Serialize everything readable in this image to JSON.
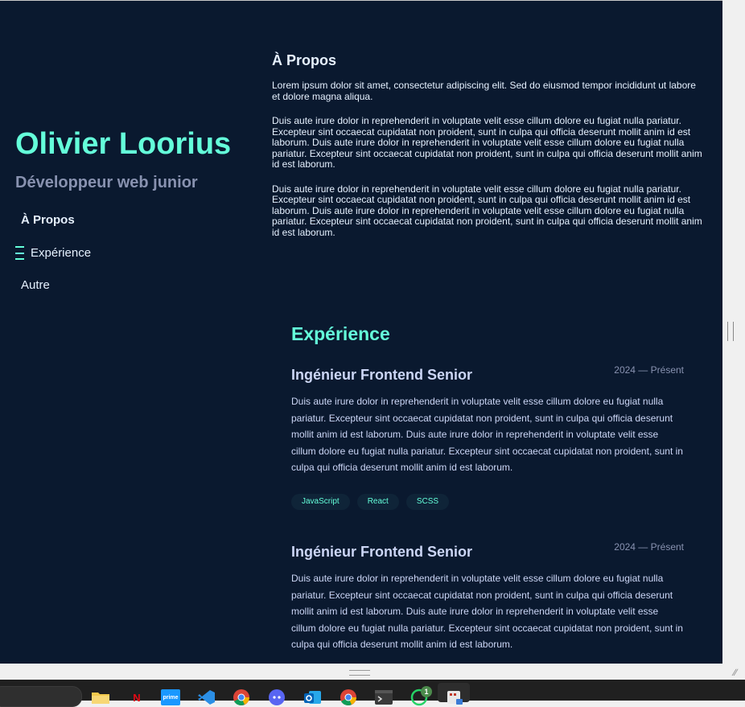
{
  "profile": {
    "name": "Olivier Loorius",
    "role": "Développeur web junior"
  },
  "nav": {
    "items": [
      {
        "label": "À Propos"
      },
      {
        "label": "Expérience"
      },
      {
        "label": "Autre"
      }
    ]
  },
  "about": {
    "title": "À Propos",
    "paragraphs": [
      "Lorem ipsum dolor sit amet, consectetur adipiscing elit. Sed do eiusmod tempor incididunt ut labore et dolore magna aliqua.",
      "Duis aute irure dolor in reprehenderit in voluptate velit esse cillum dolore eu fugiat nulla pariatur. Excepteur sint occaecat cupidatat non proident, sunt in culpa qui officia deserunt mollit anim id est laborum. Duis aute irure dolor in reprehenderit in voluptate velit esse cillum dolore eu fugiat nulla pariatur. Excepteur sint occaecat cupidatat non proident, sunt in culpa qui officia deserunt mollit anim id est laborum.",
      "Duis aute irure dolor in reprehenderit in voluptate velit esse cillum dolore eu fugiat nulla pariatur. Excepteur sint occaecat cupidatat non proident, sunt in culpa qui officia deserunt mollit anim id est laborum. Duis aute irure dolor in reprehenderit in voluptate velit esse cillum dolore eu fugiat nulla pariatur. Excepteur sint occaecat cupidatat non proident, sunt in culpa qui officia deserunt mollit anim id est laborum."
    ]
  },
  "experience": {
    "title": "Expérience",
    "jobs": [
      {
        "title": "Ingénieur Frontend Senior",
        "date": "2024 — Présent",
        "description": "Duis aute irure dolor in reprehenderit in voluptate velit esse cillum dolore eu fugiat nulla pariatur. Excepteur sint occaecat cupidatat non proident, sunt in culpa qui officia deserunt mollit anim id est laborum. Duis aute irure dolor in reprehenderit in voluptate velit esse cillum dolore eu fugiat nulla pariatur. Excepteur sint occaecat cupidatat non proident, sunt in culpa qui officia deserunt mollit anim id est laborum.",
        "tags": [
          "JavaScript",
          "React",
          "SCSS"
        ]
      },
      {
        "title": "Ingénieur Frontend Senior",
        "date": "2024 — Présent",
        "description": "Duis aute irure dolor in reprehenderit in voluptate velit esse cillum dolore eu fugiat nulla pariatur. Excepteur sint occaecat cupidatat non proident, sunt in culpa qui officia deserunt mollit anim id est laborum. Duis aute irure dolor in reprehenderit in voluptate velit esse cillum dolore eu fugiat nulla pariatur. Excepteur sint occaecat cupidatat non proident, sunt in culpa qui officia deserunt mollit anim id est laborum."
      }
    ]
  },
  "taskbar": {
    "netflix_glyph": "N",
    "prime_glyph": "prime",
    "whatsapp_badge": "1"
  },
  "colors": {
    "background": "#0a192f",
    "accent": "#64ffda",
    "text_light": "#ccd6f6",
    "text_muted": "#8892b0"
  }
}
